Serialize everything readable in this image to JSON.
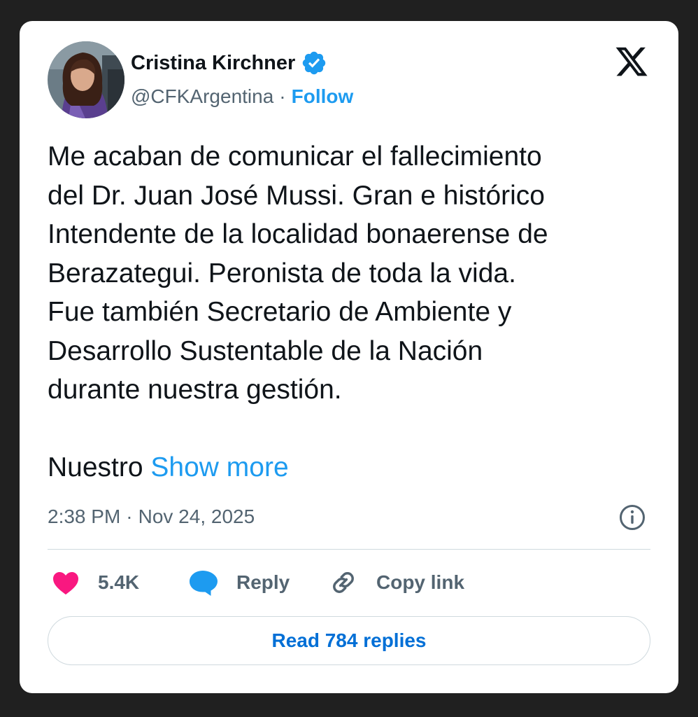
{
  "tweet": {
    "author_name": "Cristina Kirchner",
    "handle": "@CFKArgentina",
    "separator": "·",
    "follow_label": "Follow",
    "text": "Me acaban de comunicar el fallecimiento\ndel Dr. Juan José Mussi. Gran e histórico\nIntendente de la localidad bonaerense de\nBerazategui. Peronista de toda la vida.\nFue también Secretario de Ambiente y\nDesarrollo Sustentable de la Nación\ndurante nuestra gestión.",
    "truncated_start": "Nuestro",
    "show_more_label": "Show more",
    "time": "2:38 PM",
    "date": "Nov 24, 2025"
  },
  "actions": {
    "likes": "5.4K",
    "reply_label": "Reply",
    "copy_link_label": "Copy link",
    "read_replies_label": "Read 784 replies"
  },
  "icons": {
    "verified": "verified-badge-icon",
    "brand": "x-logo-icon",
    "info": "info-icon",
    "like": "heart-icon",
    "reply": "speech-bubble-icon",
    "copy": "link-icon"
  },
  "colors": {
    "accent": "#1d9bf0",
    "link_button": "#006fd6",
    "like": "#f91880",
    "text": "#0f1419",
    "muted": "#536471"
  }
}
